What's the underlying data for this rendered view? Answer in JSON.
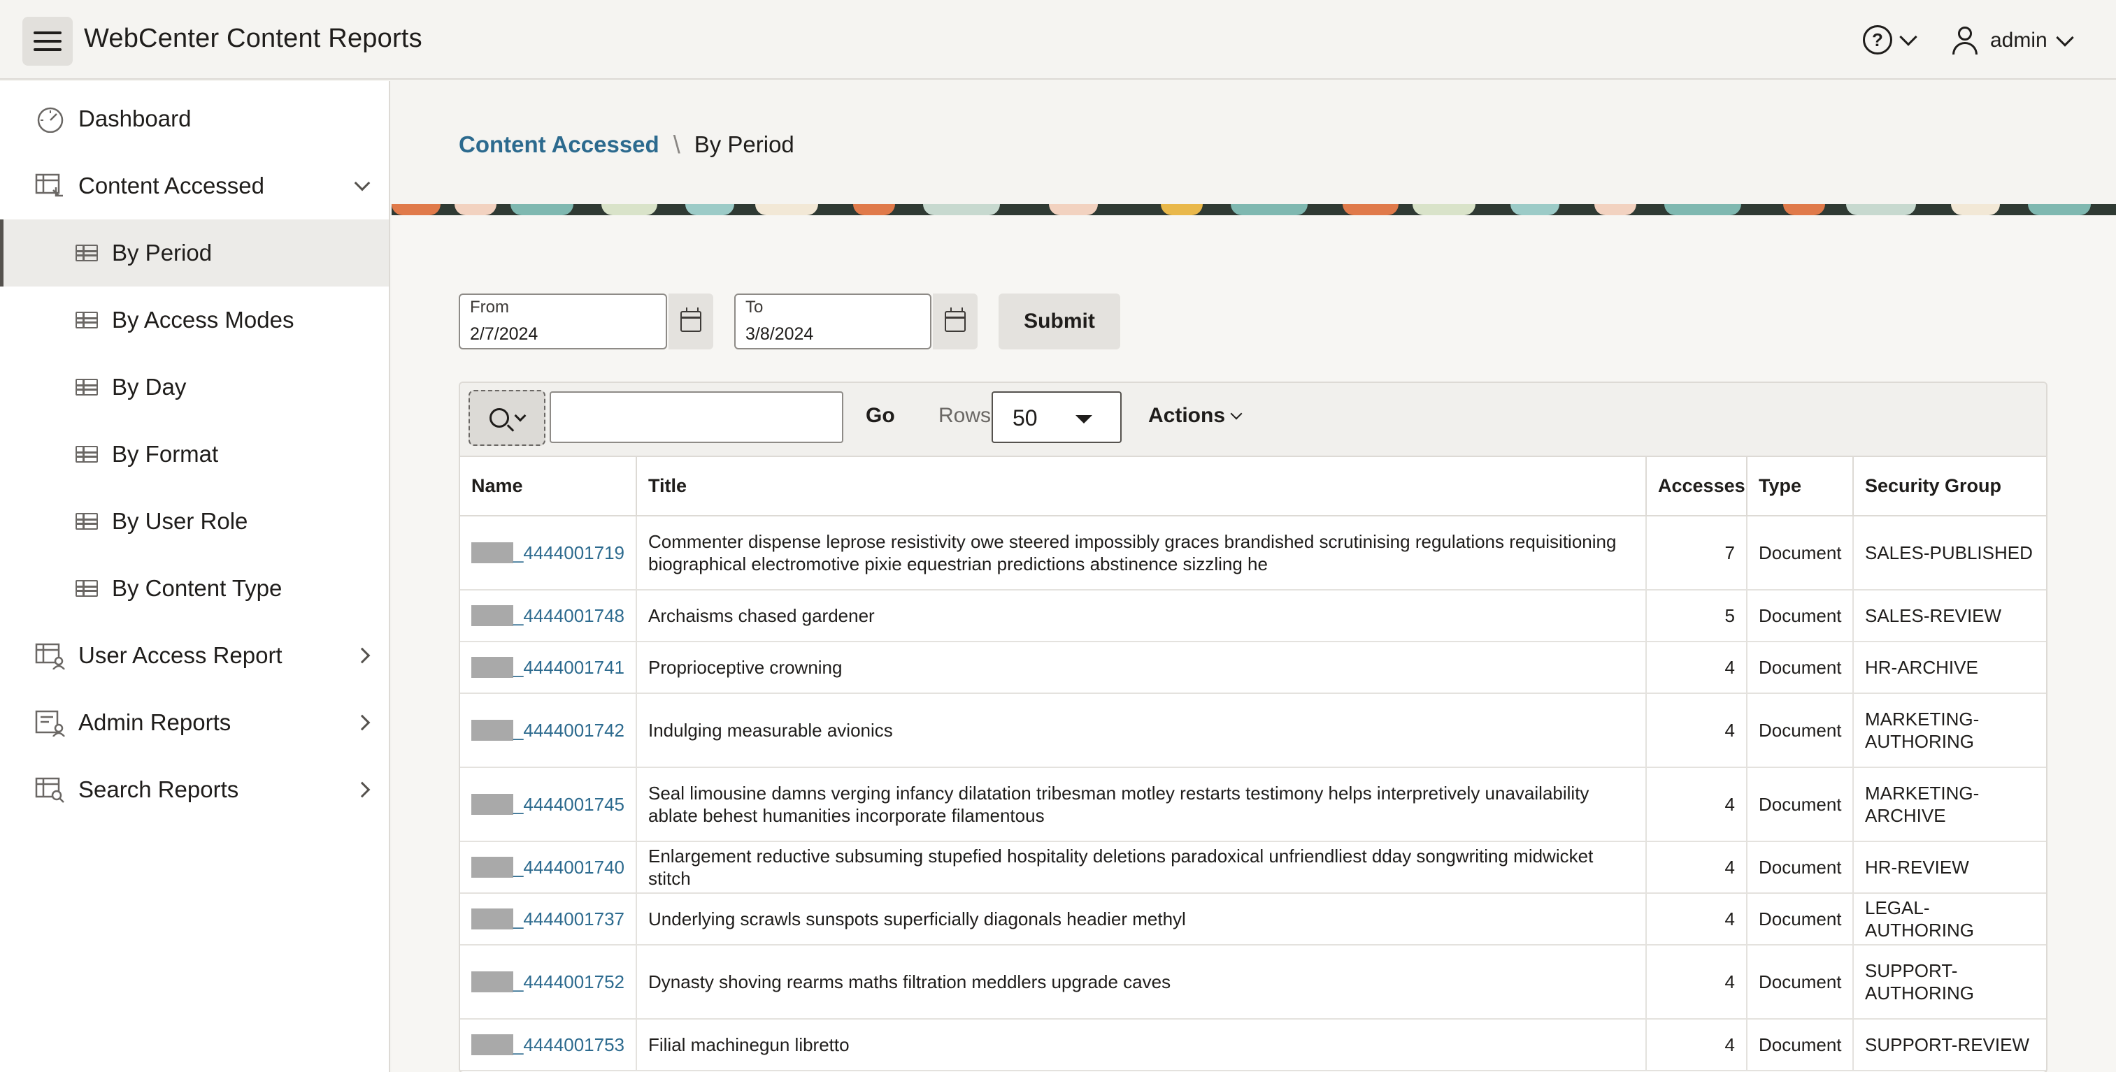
{
  "header": {
    "app_title": "WebCenter Content Reports",
    "user_name": "admin"
  },
  "sidebar": {
    "items": [
      {
        "label": "Dashboard"
      },
      {
        "label": "Content Accessed"
      },
      {
        "label": "User Access Report"
      },
      {
        "label": "Admin Reports"
      },
      {
        "label": "Search Reports"
      }
    ],
    "sub_items": [
      {
        "label": "By Period",
        "active": true
      },
      {
        "label": "By Access Modes"
      },
      {
        "label": "By Day"
      },
      {
        "label": "By Format"
      },
      {
        "label": "By User Role"
      },
      {
        "label": "By Content Type"
      }
    ]
  },
  "breadcrumb": {
    "parent": "Content Accessed",
    "separator": "\\",
    "current": "By Period"
  },
  "filters": {
    "from_label": "From",
    "from_value": "2/7/2024",
    "to_label": "To",
    "to_value": "3/8/2024",
    "submit_label": "Submit"
  },
  "toolbar": {
    "search_value": "",
    "go_label": "Go",
    "rows_label": "Rows",
    "rows_value": "50",
    "actions_label": "Actions"
  },
  "table": {
    "headers": [
      "Name",
      "Title",
      "Accesses",
      "Type",
      "Security Group"
    ],
    "rows": [
      {
        "name": "_4444001719",
        "title": "Commenter dispense leprose resistivity owe steered impossibly graces brandished scrutinising regulations requisitioning biographical electromotive pixie equestrian predictions abstinence sizzling he",
        "accesses": "7",
        "type": "Document",
        "group": "SALES-PUBLISHED"
      },
      {
        "name": "_4444001748",
        "title": "Archaisms chased gardener",
        "accesses": "5",
        "type": "Document",
        "group": "SALES-REVIEW"
      },
      {
        "name": "_4444001741",
        "title": "Proprioceptive crowning",
        "accesses": "4",
        "type": "Document",
        "group": "HR-ARCHIVE"
      },
      {
        "name": "_4444001742",
        "title": "Indulging measurable avionics",
        "accesses": "4",
        "type": "Document",
        "group": "MARKETING-AUTHORING"
      },
      {
        "name": "_4444001745",
        "title": "Seal limousine damns verging infancy dilatation tribesman motley restarts testimony helps interpretively unavailability ablate behest humanities incorporate filamentous",
        "accesses": "4",
        "type": "Document",
        "group": "MARKETING-ARCHIVE"
      },
      {
        "name": "_4444001740",
        "title": "Enlargement reductive subsuming stupefied hospitality deletions paradoxical unfriendliest dday songwriting midwicket stitch",
        "accesses": "4",
        "type": "Document",
        "group": "HR-REVIEW"
      },
      {
        "name": "_4444001737",
        "title": "Underlying scrawls sunspots superficially diagonals headier methyl",
        "accesses": "4",
        "type": "Document",
        "group": "LEGAL-AUTHORING"
      },
      {
        "name": "_4444001752",
        "title": "Dynasty shoving rearms maths filtration meddlers upgrade caves",
        "accesses": "4",
        "type": "Document",
        "group": "SUPPORT-AUTHORING"
      },
      {
        "name": "_4444001753",
        "title": "Filial machinegun libretto",
        "accesses": "4",
        "type": "Document",
        "group": "SUPPORT-REVIEW"
      }
    ]
  }
}
